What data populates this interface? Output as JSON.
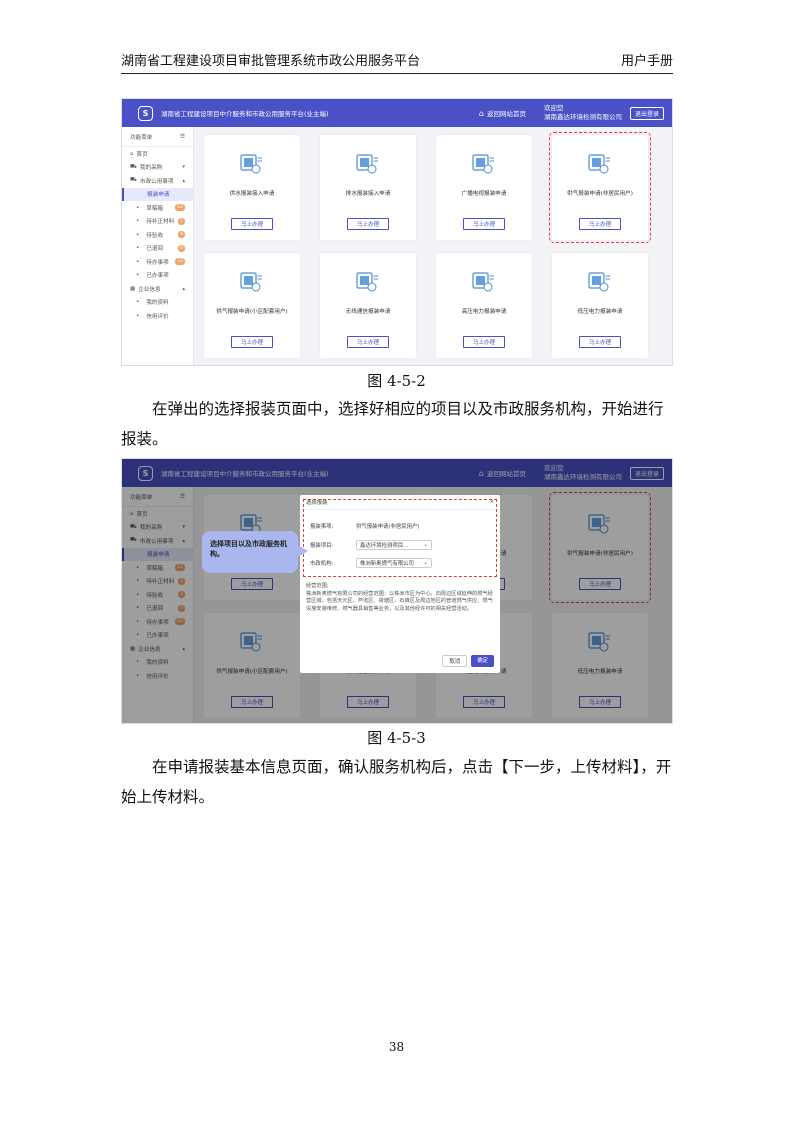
{
  "header": {
    "title": "湖南省工程建设项目审批管理系统市政公用服务平台",
    "right": "用户手册"
  },
  "app": {
    "logo": "S",
    "title": "湖南省工程建设项目中介服务和市政公用服务平台(业主端)",
    "home_label": "返回网站首页",
    "user_line1": "欢迎您",
    "user_line2": "湖南鑫达环境检测有限公司",
    "logout": "退出登录",
    "sidebar": {
      "title": "功能菜单",
      "items": [
        {
          "label": "首页",
          "icon": "home-icon",
          "type": "top"
        },
        {
          "label": "我的采购",
          "icon": "cart-icon",
          "type": "top",
          "caret": "▾"
        },
        {
          "label": "市政公用事项",
          "icon": "cart-icon",
          "type": "top",
          "caret": "▴"
        },
        {
          "label": "报装申请",
          "type": "active"
        },
        {
          "label": "草稿箱",
          "type": "sub",
          "badge": "12"
        },
        {
          "label": "待补正材料",
          "type": "sub",
          "badge": "2"
        },
        {
          "label": "待验收",
          "type": "sub",
          "badge": "4"
        },
        {
          "label": "已退回",
          "type": "sub",
          "badge": "0"
        },
        {
          "label": "待办事项",
          "type": "sub",
          "badge": "23"
        },
        {
          "label": "已办事项",
          "type": "sub"
        },
        {
          "label": "企业信息",
          "icon": "building-icon",
          "type": "top",
          "caret": "▴"
        },
        {
          "label": "我的资料",
          "type": "sub"
        },
        {
          "label": "信用评价",
          "type": "sub"
        }
      ]
    },
    "cards": [
      {
        "label": "供水报装接入申请",
        "icon": "water-icon",
        "button": "马上办理"
      },
      {
        "label": "排水报装接入申请",
        "icon": "drain-icon",
        "button": "马上办理"
      },
      {
        "label": "广播电视报装申请",
        "icon": "tv-icon",
        "button": "马上办理"
      },
      {
        "label": "供气报装申请(非居民用户)",
        "icon": "gas-icon",
        "button": "马上办理",
        "highlight": true
      },
      {
        "label": "供气报装申请(小区配套用户)",
        "icon": "gas-icon",
        "button": "马上办理"
      },
      {
        "label": "无线通信报装申请",
        "icon": "signal-icon",
        "button": "马上办理"
      },
      {
        "label": "高压电力报装申请",
        "icon": "power-icon",
        "button": "马上办理"
      },
      {
        "label": "低压电力报装申请",
        "icon": "power-icon",
        "button": "马上办理"
      }
    ]
  },
  "figure1_caption": "图 4-5-2",
  "paragraph1": "在弹出的选择报装页面中，选择好相应的项目以及市政服务机构，开始进行报装。",
  "dialog": {
    "title": "选择报装",
    "close": "×",
    "matter_label": "报装事项:",
    "matter_value": "供气报装申请(非居民用户)",
    "project_label": "报装项目:",
    "project_value": "鑫达环境检测项目…",
    "org_label": "市政机构:",
    "org_value": "株洲新奥燃气有限公司",
    "scope_title": "经营范围:",
    "scope_text": "株洲新奥燃气有限公司的经营范围：以株洲市区为中心，向周边区域延伸的燃气经营区域，包括天元区、芦淞区、荷塘区、石峰区及周边地区的管道燃气供应、燃气设施安装维修、燃气器具销售等业务，以及其他经许可的相关经营活动。",
    "cancel": "取消",
    "ok": "确定"
  },
  "callout": "选择项目以及市政服务机构。",
  "figure2_caption": "图 4-5-3",
  "paragraph2": "在申请报装基本信息页面，确认服务机构后，点击【下一步，上传材料】，开始上传材料。",
  "page_number": "38",
  "colors": {
    "primary": "#4a50c6",
    "highlight": "#e53935",
    "badge": "#f2a36a"
  }
}
